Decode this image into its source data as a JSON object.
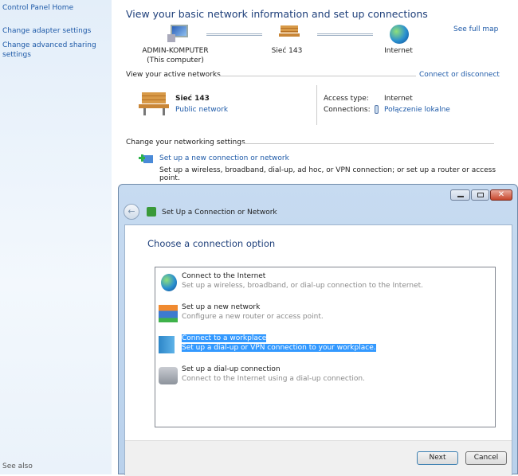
{
  "sidebar": {
    "home": "Control Panel Home",
    "adapter": "Change adapter settings",
    "sharing1": "Change advanced sharing",
    "sharing2": "settings",
    "see_also": "See also"
  },
  "main": {
    "title": "View your basic network information and set up connections",
    "see_full_map": "See full map",
    "map": {
      "computer": "ADMIN-KOMPUTER",
      "computer_sub": "(This computer)",
      "network": "Sieć  143",
      "internet": "Internet"
    },
    "active_header": "View your active networks",
    "connect_disconnect": "Connect or disconnect",
    "active": {
      "name": "Sieć  143",
      "type": "Public network",
      "access_label": "Access type:",
      "access_value": "Internet",
      "conn_label": "Connections:",
      "conn_value": "Połączenie lokalne"
    },
    "change_header": "Change your networking settings",
    "setup_link": "Set up a new connection or network",
    "setup_desc": "Set up a wireless, broadband, dial-up, ad hoc, or VPN connection; or set up a router or access point."
  },
  "dialog": {
    "title": "Set Up a Connection or Network",
    "heading": "Choose a connection option",
    "options": [
      {
        "title": "Connect to the Internet",
        "desc": "Set up a wireless, broadband, or dial-up connection to the Internet."
      },
      {
        "title": "Set up a new network",
        "desc": "Configure a new router or access point."
      },
      {
        "title": "Connect to a workplace",
        "desc": "Set up a dial-up or VPN connection to your workplace."
      },
      {
        "title": "Set up a dial-up connection",
        "desc": "Connect to the Internet using a dial-up connection."
      }
    ],
    "selected_index": 2,
    "next": "Next",
    "cancel": "Cancel"
  }
}
